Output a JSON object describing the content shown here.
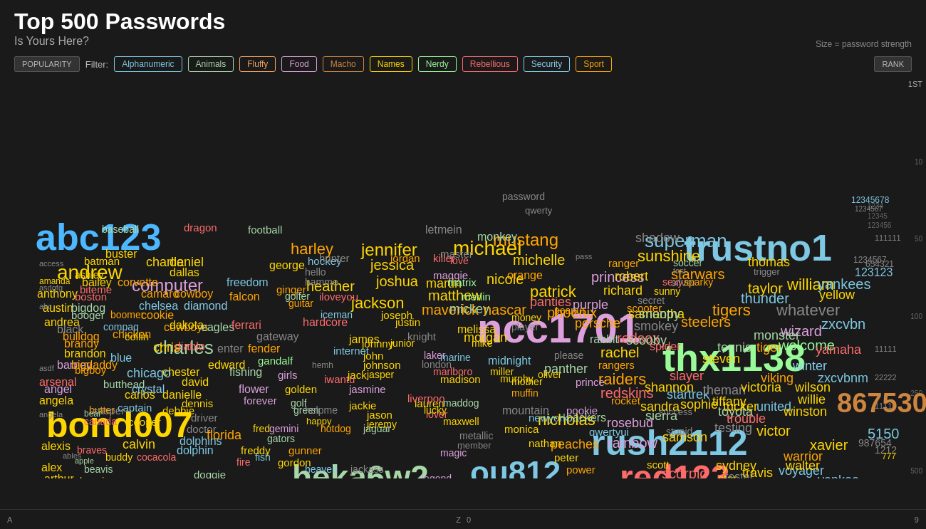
{
  "header": {
    "title": "Top 500 Passwords",
    "subtitle": "Is Yours Here?",
    "size_label": "Size = password strength"
  },
  "controls": {
    "popularity_label": "POPULARITY",
    "filter_label": "Filter:",
    "rank_label": "RANK",
    "filters": [
      {
        "id": "alphanumeric",
        "label": "Alphanumeric",
        "class": "filter-alphanumeric"
      },
      {
        "id": "animals",
        "label": "Animals",
        "class": "filter-animals"
      },
      {
        "id": "fluffy",
        "label": "Fluffy",
        "class": "filter-fluffy"
      },
      {
        "id": "food",
        "label": "Food",
        "class": "filter-food"
      },
      {
        "id": "macho",
        "label": "Macho",
        "class": "filter-macho"
      },
      {
        "id": "names",
        "label": "Names",
        "class": "filter-names"
      },
      {
        "id": "nerdy",
        "label": "Nerdy",
        "class": "filter-nerdy"
      },
      {
        "id": "rebellious",
        "label": "Rebellious",
        "class": "filter-rebellious"
      },
      {
        "id": "security",
        "label": "Security",
        "class": "filter-security"
      },
      {
        "id": "sport",
        "label": "Sport",
        "class": "filter-sport"
      }
    ]
  },
  "bottom": {
    "left": "A",
    "middle_left": "Z",
    "middle_right": "0",
    "right": "9"
  },
  "y_axis": {
    "labels": [
      "1ST",
      "10",
      "50",
      "100",
      "250",
      "500"
    ]
  }
}
